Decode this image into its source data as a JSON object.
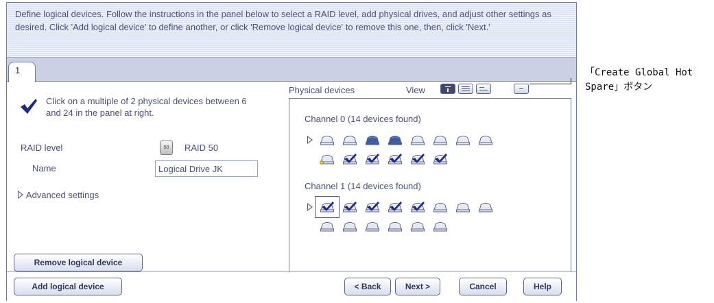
{
  "instructions": "Define logical devices. Follow the instructions in the panel below to select a RAID level, add physical drives, and adjust other settings as desired. Click 'Add logical device' to define another, or click 'Remove logical device' to remove this one, then, click 'Next.'",
  "tab": {
    "label": "1"
  },
  "left": {
    "hint": "Click on a multiple of 2 physical devices between 6 and 24 in the panel at right.",
    "raid_label": "RAID level",
    "raid_icon_text": "50",
    "raid_value": "RAID 50",
    "name_label": "Name",
    "name_value": "Logical Drive JK",
    "advanced": "Advanced settings",
    "remove_button": "Remove logical device"
  },
  "right": {
    "physical_label": "Physical devices",
    "view_label": "View",
    "channels": [
      {
        "title": "Channel 0   (14 devices found)",
        "devices": [
          "available",
          "available",
          "used",
          "used",
          "available",
          "available",
          "available",
          "available",
          "hotspare",
          "selected",
          "selected",
          "selected",
          "selected",
          "selected"
        ]
      },
      {
        "title": "Channel 1   (14 devices found)",
        "devices": [
          "selected-focus",
          "selected",
          "selected",
          "selected",
          "selected",
          "available",
          "available",
          "available",
          "available",
          "available",
          "available",
          "available",
          "available",
          "available"
        ]
      }
    ]
  },
  "buttons": {
    "add": "Add logical device",
    "back": "< Back",
    "next": "Next >",
    "cancel": "Cancel",
    "help": "Help"
  },
  "callout": {
    "line1": "「Create Global Hot",
    "line2": "Spare」ボタン"
  },
  "colors": {
    "accent": "#40486e",
    "instruction_bg": "#dfe6f3",
    "tabstrip_bg": "#c9d1e3",
    "check_blue": "#1f2a8a"
  }
}
